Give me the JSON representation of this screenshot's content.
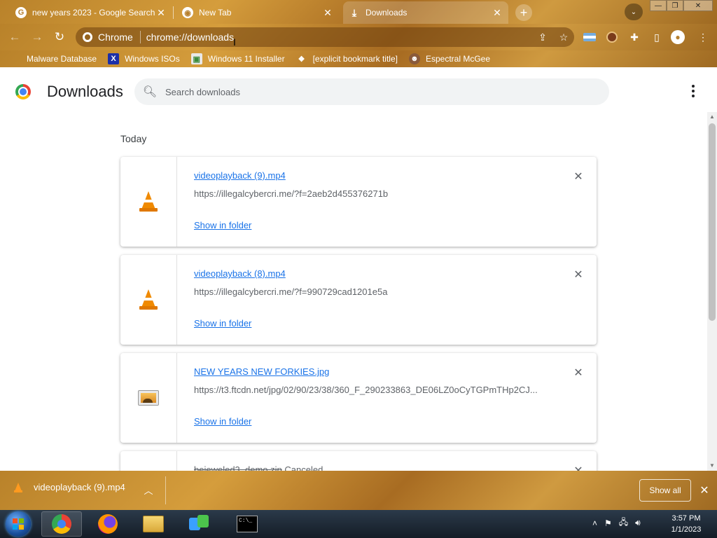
{
  "browser": {
    "tabs": [
      {
        "title": "new years 2023 - Google Search",
        "icon": "google-icon",
        "active": false
      },
      {
        "title": "New Tab",
        "icon": "chrome-icon",
        "active": false
      },
      {
        "title": "Downloads",
        "icon": "download-icon",
        "active": true
      }
    ],
    "omnibox": {
      "chip_label": "Chrome",
      "url": "chrome://downloads"
    },
    "bookmarks": [
      {
        "label": "Malware Database",
        "icon": "bookmark-icon"
      },
      {
        "label": "Windows ISOs",
        "icon": "x-icon"
      },
      {
        "label": "Windows 11 Installer",
        "icon": "image-icon"
      },
      {
        "label": "[explicit bookmark title]",
        "icon": "bookmark-icon"
      },
      {
        "label": "Espectral McGee",
        "icon": "avatar-icon"
      }
    ]
  },
  "page": {
    "title": "Downloads",
    "search_placeholder": "Search downloads",
    "section_label": "Today",
    "show_in_folder_label": "Show in folder",
    "downloads": [
      {
        "filename": "videoplayback (9).mp4",
        "url": "https://illegalcybercri.me/?f=2aeb2d455376271b",
        "icon": "vlc-cone-icon"
      },
      {
        "filename": "videoplayback (8).mp4",
        "url": "https://illegalcybercri.me/?f=990729cad1201e5a",
        "icon": "vlc-cone-icon"
      },
      {
        "filename": "NEW YEARS NEW FORKIES.jpg",
        "url": "https://t3.ftcdn.net/jpg/02/90/23/38/360_F_290233863_DE06LZ0oCyTGPmTHp2CJ...",
        "icon": "image-file-icon"
      }
    ],
    "partial_item": {
      "filename": "bejeweled3_demo.zip",
      "status": "Canceled"
    }
  },
  "download_shelf": {
    "item_name": "videoplayback (9).mp4",
    "show_all_label": "Show all"
  },
  "taskbar": {
    "time": "3:57 PM",
    "date": "1/1/2023",
    "apps": [
      "chrome-icon",
      "firefox-icon",
      "file-explorer-icon",
      "network-app-icon",
      "command-prompt-icon"
    ]
  },
  "colors": {
    "theme_accent": "#b9822a",
    "link_blue": "#1a73e8",
    "shelf": "#b77d2c"
  }
}
